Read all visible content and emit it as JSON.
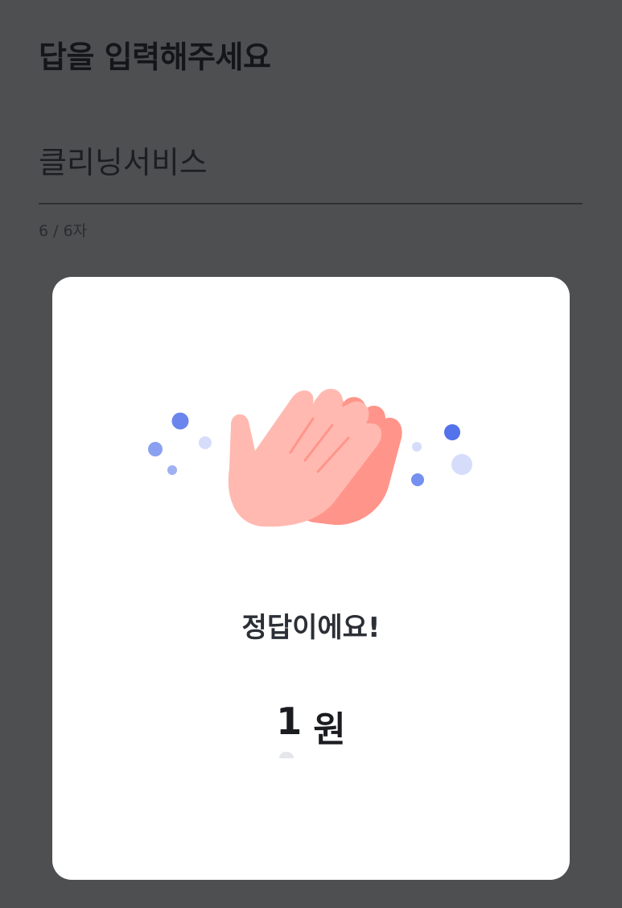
{
  "header": {
    "title": "답을 입력해주세요"
  },
  "answer": {
    "value": "클리닝서비스",
    "char_count": "6 / 6자"
  },
  "modal": {
    "illustration_icon": "clapping-hands-icon",
    "result_text": "정답이에요!",
    "reward_amount": "1",
    "reward_unit": "원"
  },
  "colors": {
    "backdrop": "#4e4f51",
    "modal_bg": "#ffffff",
    "hand_front": "#ffb9b1",
    "hand_back": "#ff958a",
    "dot_blue": "#6a85ee",
    "dot_light": "#d6ddfb"
  }
}
